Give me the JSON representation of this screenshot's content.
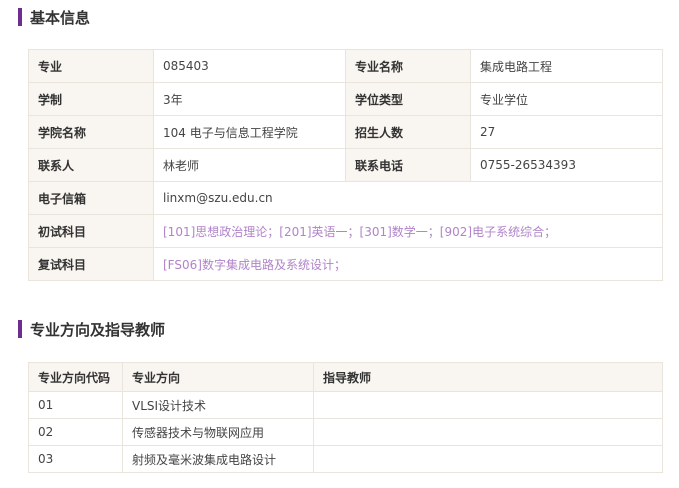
{
  "basic_section": {
    "title": "基本信息"
  },
  "basic_info": {
    "major_label": "专业",
    "major_value": "085403",
    "major_name_label": "专业名称",
    "major_name_value": "集成电路工程",
    "duration_label": "学制",
    "duration_value": "3年",
    "degree_type_label": "学位类型",
    "degree_type_value": "专业学位",
    "college_label": "学院名称",
    "college_value": "104 电子与信息工程学院",
    "enroll_label": "招生人数",
    "enroll_value": "27",
    "contact_label": "联系人",
    "contact_value": "林老师",
    "phone_label": "联系电话",
    "phone_value": "0755-26534393",
    "email_label": "电子信箱",
    "email_value": "linxm@szu.edu.cn",
    "first_exam_label": "初试科目",
    "first_exam_value": "[101]思想政治理论；[201]英语一；[301]数学一；[902]电子系统综合；",
    "retest_label": "复试科目",
    "retest_value": "[FS06]数字集成电路及系统设计；"
  },
  "directions_section": {
    "title": "专业方向及指导教师"
  },
  "directions": {
    "headers": [
      "专业方向代码",
      "专业方向",
      "指导教师"
    ],
    "rows": [
      {
        "code": "01",
        "name": "VLSI设计技术",
        "advisor": ""
      },
      {
        "code": "02",
        "name": "传感器技术与物联网应用",
        "advisor": ""
      },
      {
        "code": "03",
        "name": "射频及毫米波集成电路设计",
        "advisor": ""
      }
    ]
  }
}
